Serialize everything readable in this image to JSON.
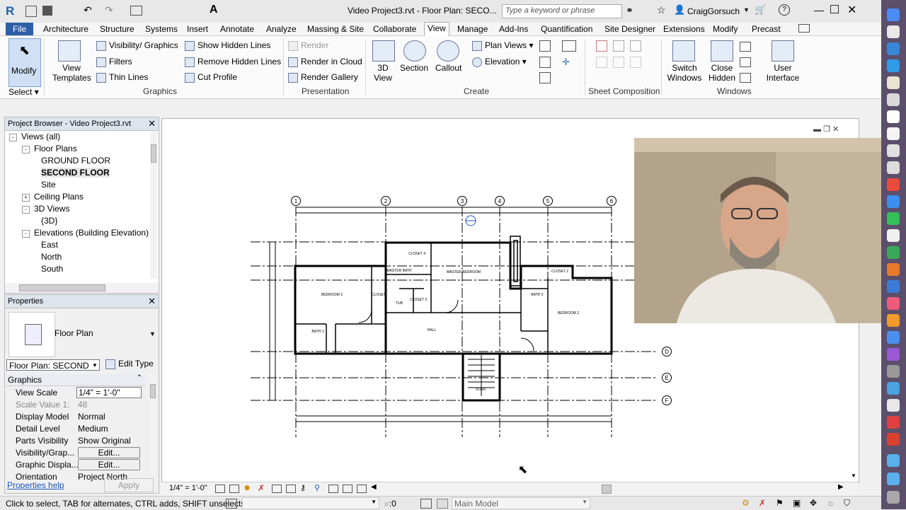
{
  "titlebar": {
    "title": "Video Project3.rvt - Floor Plan: SECO...",
    "search_placeholder": "Type a keyword or phrase",
    "user": "CraigGorsuch"
  },
  "ribbon_tabs": [
    "File",
    "Architecture",
    "Structure",
    "Systems",
    "Insert",
    "Annotate",
    "Analyze",
    "Massing & Site",
    "Collaborate",
    "View",
    "Manage",
    "Add-Ins",
    "Quantification",
    "Site Designer",
    "Extensions",
    "Modify",
    "Precast"
  ],
  "active_tab": "View",
  "ribbon": {
    "modify": "Modify",
    "select": "Select",
    "graphics": {
      "title": "Graphics",
      "view_templates": "View Templates",
      "visibility": "Visibility/ Graphics",
      "filters": "Filters",
      "thin_lines": "Thin  Lines",
      "show_hidden": "Show  Hidden Lines",
      "remove_hidden": "Remove  Hidden Lines",
      "cut_profile": "Cut  Profile"
    },
    "presentation": {
      "title": "Presentation",
      "render": "Render",
      "render_cloud": "Render  in Cloud",
      "render_gallery": "Render  Gallery"
    },
    "create": {
      "title": "Create",
      "view_3d": "3D View",
      "section": "Section",
      "callout": "Callout",
      "plan_views": "Plan  Views",
      "elevation": "Elevation"
    },
    "sheet": {
      "title": "Sheet Composition"
    },
    "windows": {
      "title": "Windows",
      "switch": "Switch Windows",
      "close_hidden": "Close Hidden",
      "user_interface": "User Interface"
    }
  },
  "project_browser": {
    "title": "Project Browser - Video Project3.rvt",
    "items": [
      {
        "label": "Views (all)",
        "indent": 0,
        "toggle": "-"
      },
      {
        "label": "Floor Plans",
        "indent": 1,
        "toggle": "-"
      },
      {
        "label": "GROUND FLOOR",
        "indent": 2,
        "toggle": ""
      },
      {
        "label": "SECOND FLOOR",
        "indent": 2,
        "toggle": "",
        "bold": true
      },
      {
        "label": "Site",
        "indent": 2,
        "toggle": ""
      },
      {
        "label": "Ceiling Plans",
        "indent": 1,
        "toggle": "+"
      },
      {
        "label": "3D Views",
        "indent": 1,
        "toggle": "-"
      },
      {
        "label": "{3D}",
        "indent": 2,
        "toggle": ""
      },
      {
        "label": "Elevations (Building Elevation)",
        "indent": 1,
        "toggle": "-"
      },
      {
        "label": "East",
        "indent": 2,
        "toggle": ""
      },
      {
        "label": "North",
        "indent": 2,
        "toggle": ""
      },
      {
        "label": "South",
        "indent": 2,
        "toggle": ""
      }
    ]
  },
  "properties": {
    "title": "Properties",
    "type": "Floor Plan",
    "instance": "Floor Plan: SECOND FL",
    "edit_type": "Edit Type",
    "group": "Graphics",
    "rows": [
      {
        "k": "View Scale",
        "v": "1/4\" = 1'-0\""
      },
      {
        "k": "Scale Value   1:",
        "v": "48"
      },
      {
        "k": "Display Model",
        "v": "Normal"
      },
      {
        "k": "Detail Level",
        "v": "Medium"
      },
      {
        "k": "Parts Visibility",
        "v": "Show Original"
      },
      {
        "k": "Visibility/Grap...",
        "v": "Edit..."
      },
      {
        "k": "Graphic Displa...",
        "v": "Edit..."
      },
      {
        "k": "Orientation",
        "v": "Project North"
      }
    ],
    "help": "Properties help",
    "apply": "Apply"
  },
  "floorplan": {
    "grid_top": [
      "1",
      "2",
      "3",
      "4",
      "5",
      "6"
    ],
    "grid_right": [
      "D",
      "E",
      "F"
    ],
    "rooms": [
      "CLOSET 4",
      "MASTER BATH",
      "MASTER BEDROOM",
      "BEDROOM 3",
      "CLOSET",
      "TUB",
      "CLOSET 3",
      "BATH 2",
      "HALL",
      "BEDROOM 2",
      "CLOSET 2",
      "BATH 1",
      "STAIR"
    ]
  },
  "viewbar": {
    "scale": "1/4\" = 1'-0\""
  },
  "statusbar": {
    "hint": "Click to select, TAB for alternates, CTRL adds, SHIFT unselects",
    "zero": ":0",
    "model": "Main Model"
  },
  "colors": {
    "file_tab": "#2f5ea8",
    "strip": "#5b4f6c"
  }
}
